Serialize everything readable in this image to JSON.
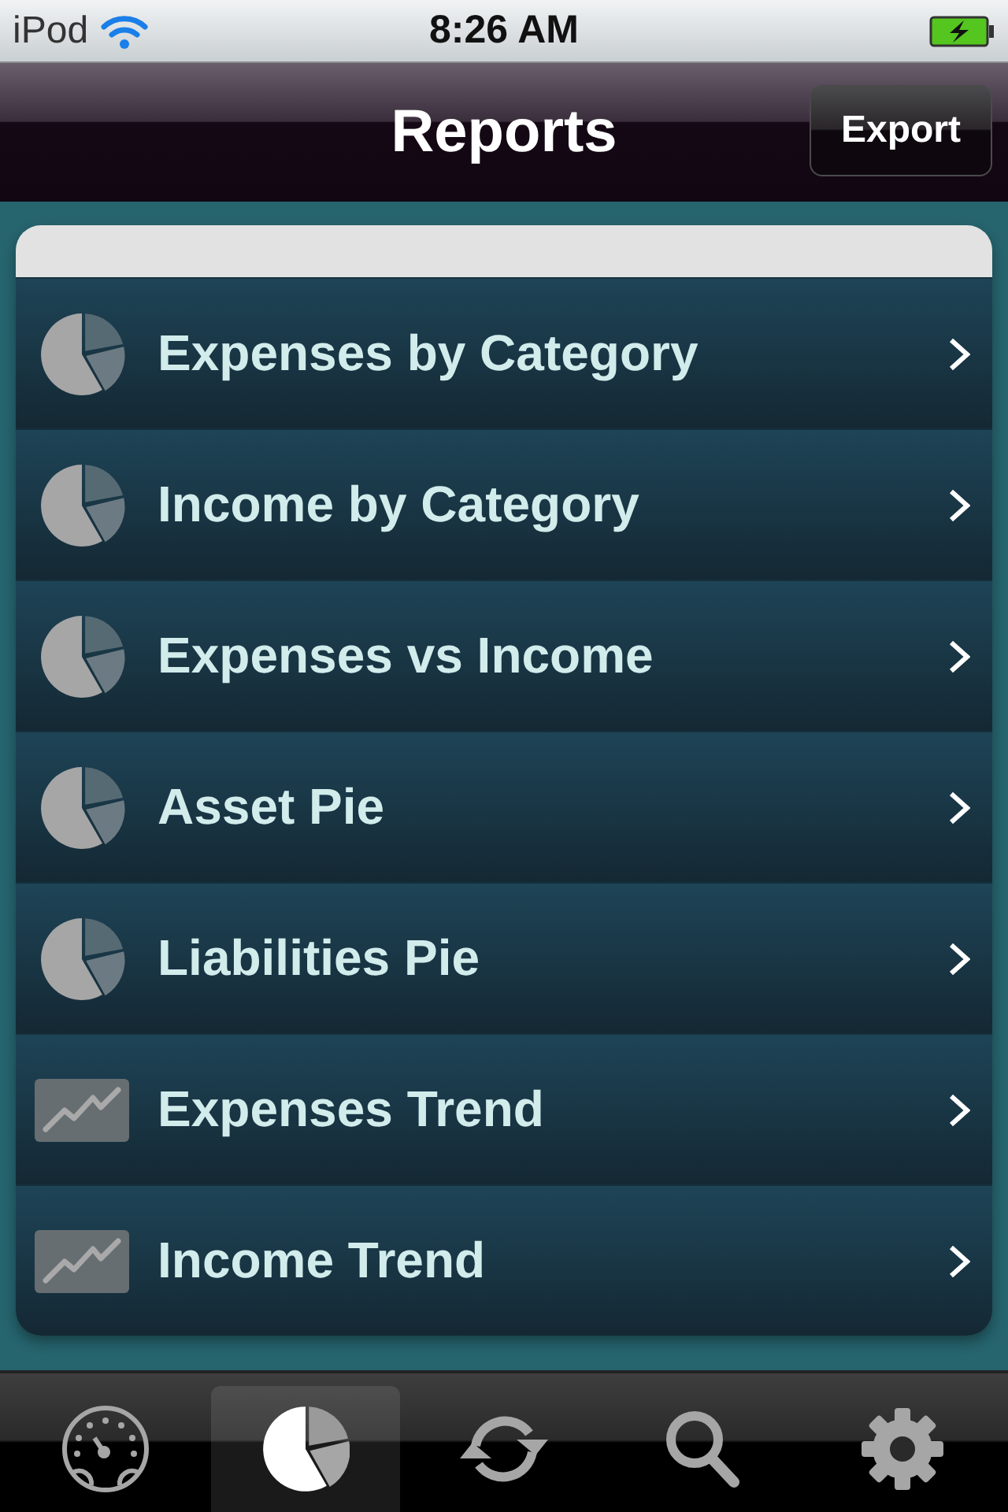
{
  "status_bar": {
    "carrier": "iPod",
    "time": "8:26 AM"
  },
  "nav_bar": {
    "title": "Reports",
    "export_button": "Export"
  },
  "reports": [
    {
      "kind": "pie",
      "label": "Expenses by Category"
    },
    {
      "kind": "pie",
      "label": "Income by Category"
    },
    {
      "kind": "pie",
      "label": "Expenses vs Income"
    },
    {
      "kind": "pie",
      "label": "Asset Pie"
    },
    {
      "kind": "pie",
      "label": "Liabilities Pie"
    },
    {
      "kind": "trend",
      "label": "Expenses Trend"
    },
    {
      "kind": "trend",
      "label": "Income Trend"
    }
  ],
  "tab_bar": [
    {
      "kind": "dashboard",
      "selected": false
    },
    {
      "kind": "reports",
      "selected": true
    },
    {
      "kind": "sync",
      "selected": false
    },
    {
      "kind": "search",
      "selected": false
    },
    {
      "kind": "settings",
      "selected": false
    }
  ]
}
